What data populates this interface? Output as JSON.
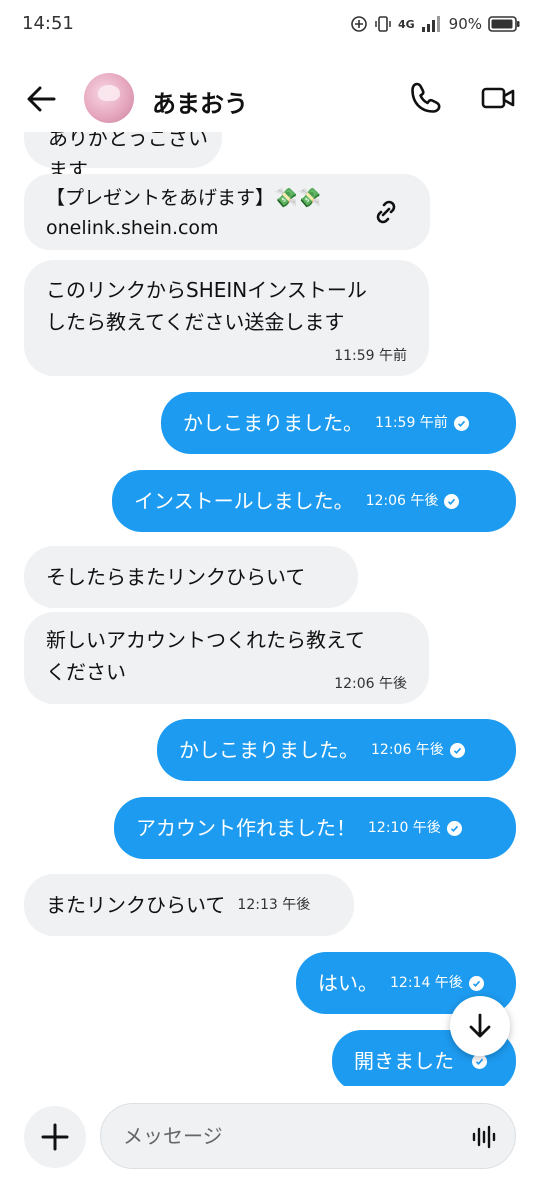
{
  "status_bar": {
    "time": "14:51",
    "network": "4G",
    "battery": "90%"
  },
  "header": {
    "contact_name": "あまおう",
    "back_icon": "arrow-left-icon",
    "call_icon": "phone-icon",
    "video_icon": "video-camera-icon"
  },
  "messages": [
    {
      "direction": "in",
      "text": "ありがとうございます",
      "partially_hidden": true
    },
    {
      "direction": "in",
      "type": "link",
      "title": "【プレゼントをあげます】💸💸",
      "url_text": "onelink.shein.com"
    },
    {
      "direction": "in",
      "text": "このリンクからSHEINインストール\nしたら教えてください送金します",
      "time": "11:59 午前"
    },
    {
      "direction": "out",
      "text": "かしこまりました。",
      "time": "11:59 午前"
    },
    {
      "direction": "out",
      "text": "インストールしました。",
      "time": "12:06 午後"
    },
    {
      "direction": "in",
      "text": "そしたらまたリンクひらいて"
    },
    {
      "direction": "in",
      "text": "新しいアカウントつくれたら教えて\nください",
      "time": "12:06 午後"
    },
    {
      "direction": "out",
      "text": "かしこまりました。",
      "time": "12:06 午後"
    },
    {
      "direction": "out",
      "text": "アカウント作れました！",
      "time": "12:10 午後"
    },
    {
      "direction": "in",
      "text": "またリンクひらいて",
      "time": "12:13 午後"
    },
    {
      "direction": "out",
      "text": "はい。",
      "time": "12:14 午後"
    },
    {
      "direction": "out",
      "text": "開きました"
    }
  ],
  "composer": {
    "placeholder": "メッセージ",
    "add_icon": "plus-icon",
    "voice_icon": "voice-wave-icon"
  },
  "colors": {
    "outgoing": "#1d9bf0",
    "incoming": "#eff1f3"
  }
}
